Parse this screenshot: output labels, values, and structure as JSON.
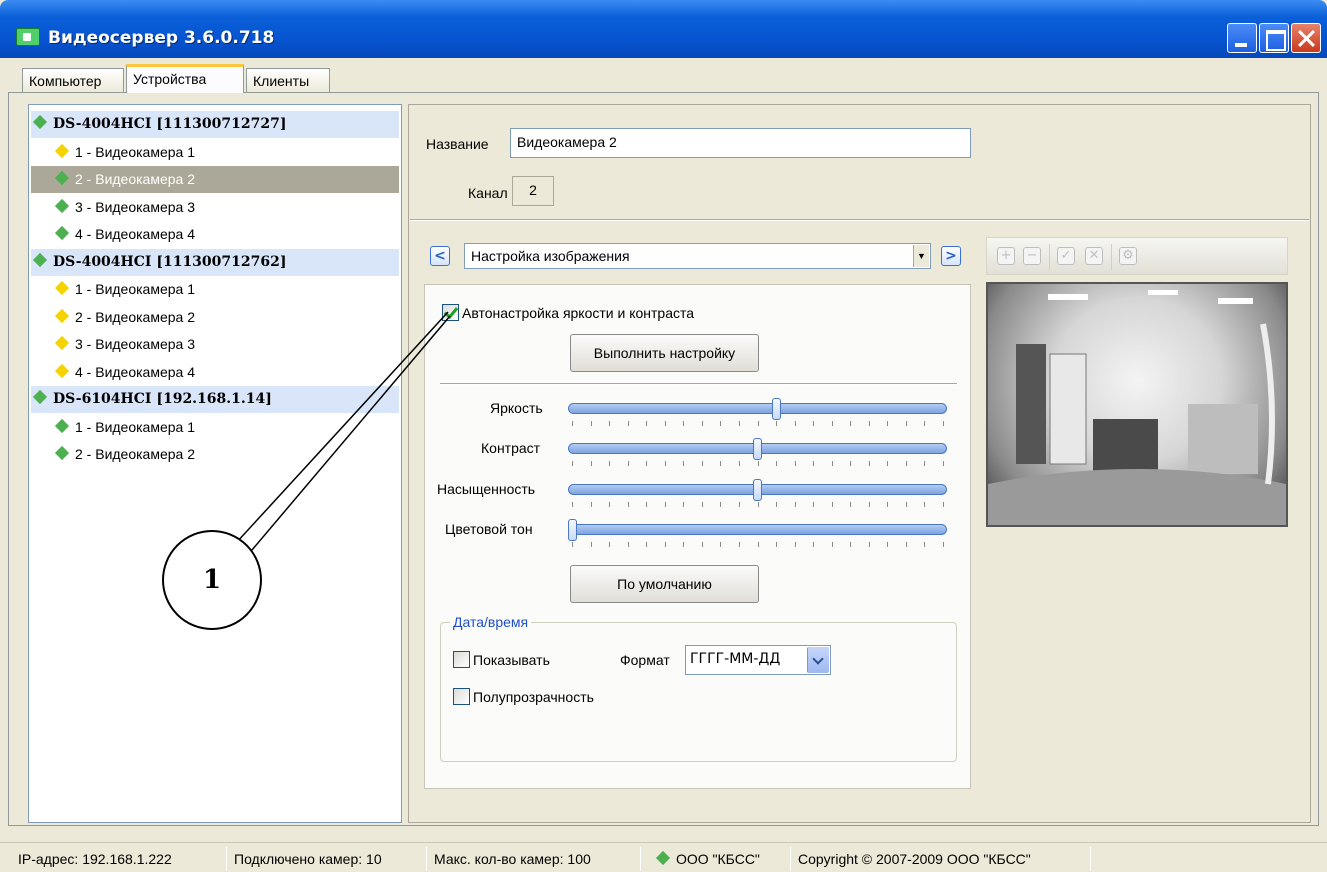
{
  "window": {
    "title": "Видеосервер 3.6.0.718"
  },
  "tabs": [
    {
      "label": "Компьютер"
    },
    {
      "label": "Устройства"
    },
    {
      "label": "Клиенты"
    }
  ],
  "tree": [
    {
      "label": "DS-4004HCI [111300712727]",
      "type": "device",
      "status": "green"
    },
    {
      "label": "1 - Видеокамера 1",
      "type": "camera",
      "status": "yellow"
    },
    {
      "label": "2 - Видеокамера 2",
      "type": "camera",
      "status": "green",
      "selected": true
    },
    {
      "label": "3 - Видеокамера 3",
      "type": "camera",
      "status": "green"
    },
    {
      "label": "4 - Видеокамера 4",
      "type": "camera",
      "status": "green"
    },
    {
      "label": "DS-4004HCI [111300712762]",
      "type": "device",
      "status": "green"
    },
    {
      "label": "1 - Видеокамера 1",
      "type": "camera",
      "status": "yellow"
    },
    {
      "label": "2 - Видеокамера 2",
      "type": "camera",
      "status": "yellow"
    },
    {
      "label": "3 - Видеокамера 3",
      "type": "camera",
      "status": "yellow"
    },
    {
      "label": "4 - Видеокамера 4",
      "type": "camera",
      "status": "yellow"
    },
    {
      "label": "DS-6104HCI [192.168.1.14]",
      "type": "device",
      "status": "green"
    },
    {
      "label": "1 - Видеокамера 1",
      "type": "camera",
      "status": "green"
    },
    {
      "label": "2 - Видеокамера 2",
      "type": "camera",
      "status": "green"
    }
  ],
  "camera": {
    "name_label": "Название",
    "name_value": "Видеокамера 2",
    "channel_label": "Канал",
    "channel_value": "2"
  },
  "settings": {
    "section": "Настройка изображения",
    "auto_adjust_label": "Автонастройка яркости и контраста",
    "auto_adjust_checked": true,
    "run_button": "Выполнить настройку",
    "sliders": [
      {
        "label": "Яркость",
        "value": 0.55
      },
      {
        "label": "Контраст",
        "value": 0.5
      },
      {
        "label": "Насыщенность",
        "value": 0.5
      },
      {
        "label": "Цветовой тон",
        "value": 0.0
      }
    ],
    "default_button": "По умолчанию",
    "datetime": {
      "title": "Дата/время",
      "show_label": "Показывать",
      "show_checked": false,
      "format_label": "Формат",
      "format_value": "ГГГГ-ММ-ДД",
      "transparent_label": "Полупрозрачность",
      "transparent_checked": false
    }
  },
  "preview_toolbar": [
    "add-icon",
    "remove-icon",
    "check-icon",
    "cancel-icon",
    "settings-icon"
  ],
  "annotation": {
    "number": "1"
  },
  "status": {
    "ip": "IP-адрес: 192.168.1.222",
    "connected": "Подключено камер: 10",
    "max": "Макс. кол-во камер: 100",
    "company": "ООО \"КБСС\"",
    "copyright": "Copyright © 2007-2009 ООО \"КБСС\""
  },
  "colors": {
    "accent": "#0653d0",
    "ok": "#4caf50",
    "warn": "#f5d300",
    "selection": "#aca899"
  }
}
